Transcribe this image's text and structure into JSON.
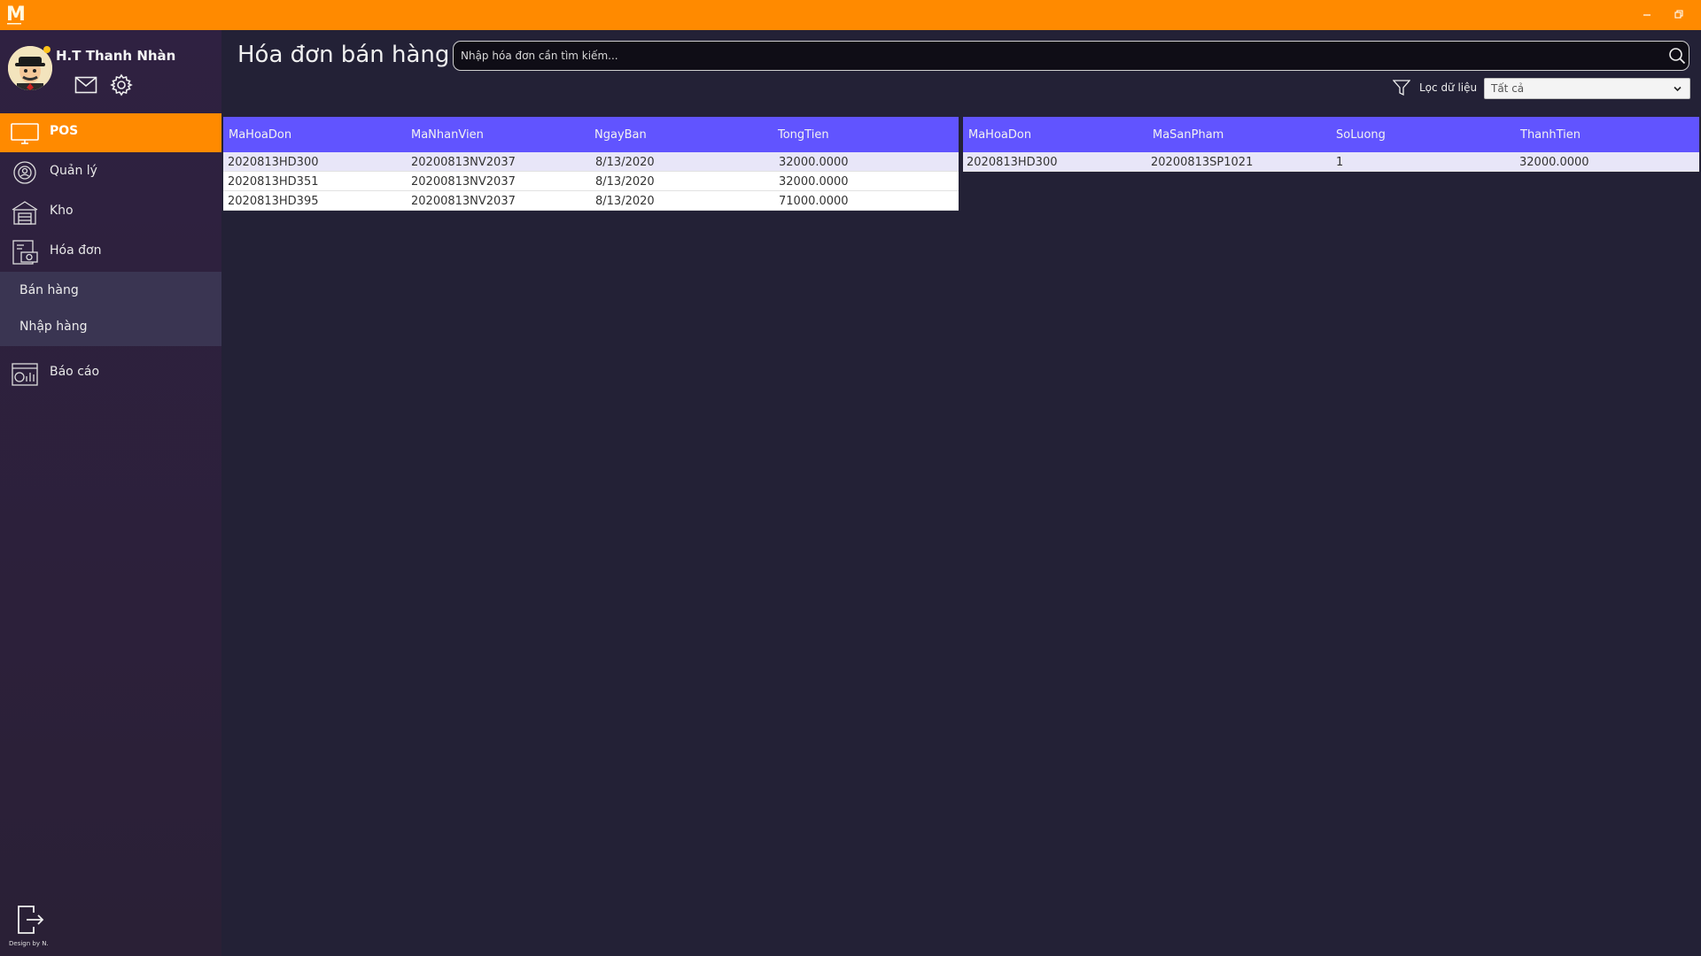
{
  "app": {
    "logo_letter": "M",
    "accent": "#ff8a00",
    "header_color": "#6154ff"
  },
  "user": {
    "name": "H.T Thanh Nhàn"
  },
  "sidebar": {
    "items": [
      {
        "label": "POS",
        "icon": "monitor-icon",
        "active": true
      },
      {
        "label": "Quản lý",
        "icon": "settings-cog-icon"
      },
      {
        "label": "Kho",
        "icon": "warehouse-icon"
      },
      {
        "label": "Hóa đơn",
        "icon": "invoice-icon"
      },
      {
        "label": "Báo cáo",
        "icon": "report-icon"
      }
    ],
    "submenu": [
      {
        "label": "Bán hàng"
      },
      {
        "label": "Nhập hàng"
      }
    ],
    "credit": "Design by N."
  },
  "header": {
    "title": "Hóa đơn bán hàng",
    "search_placeholder": "Nhập hóa đơn cần tìm kiếm...",
    "filter_label": "Lọc dữ liệu",
    "filter_value": "Tất cả"
  },
  "invoices": {
    "columns": [
      "MaHoaDon",
      "MaNhanVien",
      "NgayBan",
      "TongTien"
    ],
    "rows": [
      [
        "2020813HD300",
        "20200813NV2037",
        "8/13/2020",
        "32000.0000"
      ],
      [
        "2020813HD351",
        "20200813NV2037",
        "8/13/2020",
        "32000.0000"
      ],
      [
        "2020813HD395",
        "20200813NV2037",
        "8/13/2020",
        "71000.0000"
      ]
    ]
  },
  "details": {
    "columns": [
      "MaHoaDon",
      "MaSanPham",
      "SoLuong",
      "ThanhTien"
    ],
    "rows": [
      [
        "2020813HD300",
        "20200813SP1021",
        "1",
        "32000.0000"
      ]
    ]
  }
}
